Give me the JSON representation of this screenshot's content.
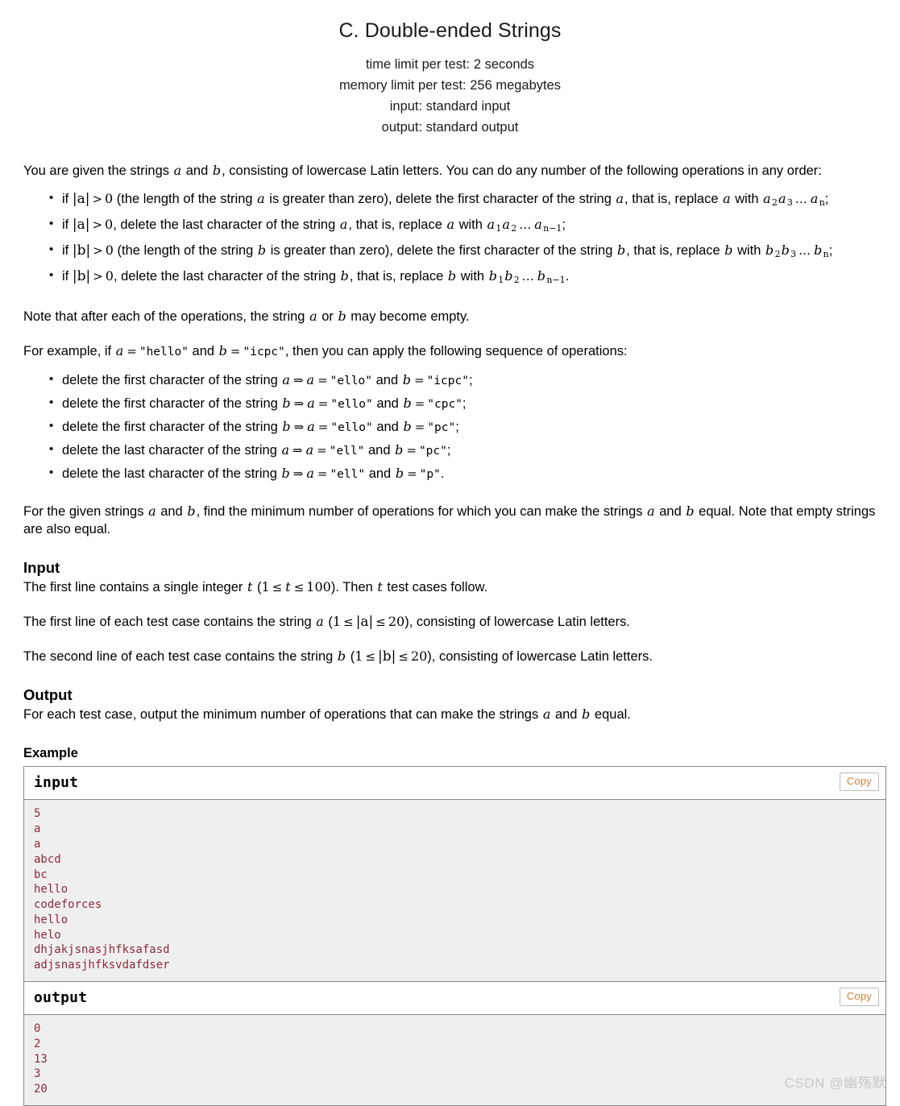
{
  "problem": {
    "title": "C. Double-ended Strings",
    "limits": [
      "time limit per test: 2 seconds",
      "memory limit per test: 256 megabytes",
      "input: standard input",
      "output: standard output"
    ],
    "intro": {
      "lead": "You are given the strings ",
      "var_a": "a",
      "mid": " and ",
      "var_b": "b",
      "tail": ", consisting of lowercase Latin letters. You can do any number of the following operations in any order:"
    },
    "operations": [
      {
        "p1": "if ",
        "abs": "|a|",
        "cmp": ">",
        "zero": "0",
        "p2": " (the length of the string ",
        "v1": "a",
        "p3": " is greater than zero), delete the first character of the string ",
        "v2": "a",
        "p4": ", that is, replace ",
        "v3": "a",
        "p5": " with ",
        "expr_base1": "a",
        "expr_sub1": "2",
        "expr_base2": "a",
        "expr_sub2": "3",
        "dots": "…",
        "expr_base3": "a",
        "expr_sub3": "n",
        "end": ";"
      },
      {
        "p1": "if ",
        "abs": "|a|",
        "cmp": ">",
        "zero": "0",
        "p2": ", delete the last character of the string ",
        "v1": "a",
        "p4": ", that is, replace ",
        "v3": "a",
        "p5": " with ",
        "expr_base1": "a",
        "expr_sub1": "1",
        "expr_base2": "a",
        "expr_sub2": "2",
        "dots": "…",
        "expr_base3": "a",
        "expr_sub3": "n−1",
        "end": ";"
      },
      {
        "p1": "if ",
        "abs": "|b|",
        "cmp": ">",
        "zero": "0",
        "p2": " (the length of the string ",
        "v1": "b",
        "p3": " is greater than zero), delete the first character of the string ",
        "v2": "b",
        "p4": ", that is, replace ",
        "v3": "b",
        "p5": " with ",
        "expr_base1": "b",
        "expr_sub1": "2",
        "expr_base2": "b",
        "expr_sub2": "3",
        "dots": "…",
        "expr_base3": "b",
        "expr_sub3": "n",
        "end": ";"
      },
      {
        "p1": "if ",
        "abs": "|b|",
        "cmp": ">",
        "zero": "0",
        "p2": ", delete the last character of the string ",
        "v1": "b",
        "p4": ", that is, replace ",
        "v3": "b",
        "p5": " with ",
        "expr_base1": "b",
        "expr_sub1": "1",
        "expr_base2": "b",
        "expr_sub2": "2",
        "dots": "…",
        "expr_base3": "b",
        "expr_sub3": "n−1",
        "end": "."
      }
    ],
    "note": {
      "p1": "Note that after each of the operations, the string ",
      "v1": "a",
      "p2": " or ",
      "v2": "b",
      "p3": " may become empty."
    },
    "example_intro": {
      "p1": "For example, if ",
      "v1": "a",
      "eq1": "=",
      "s1": "\"hello\"",
      "p2": " and ",
      "v2": "b",
      "eq2": "=",
      "s2": "\"icpc\"",
      "p3": ", then you can apply the following sequence of operations:"
    },
    "example_steps": [
      {
        "action": "delete the first character of the string ",
        "target": "a",
        "arrow": "⇒",
        "va": "a",
        "eqa": "=",
        "sa": "\"ello\"",
        "and": " and ",
        "vb": "b",
        "eqb": "=",
        "sb": "\"icpc\"",
        "end": ";"
      },
      {
        "action": "delete the first character of the string ",
        "target": "b",
        "arrow": "⇒",
        "va": "a",
        "eqa": "=",
        "sa": "\"ello\"",
        "and": " and ",
        "vb": "b",
        "eqb": "=",
        "sb": "\"cpc\"",
        "end": ";"
      },
      {
        "action": "delete the first character of the string ",
        "target": "b",
        "arrow": "⇒",
        "va": "a",
        "eqa": "=",
        "sa": "\"ello\"",
        "and": " and ",
        "vb": "b",
        "eqb": "=",
        "sb": "\"pc\"",
        "end": ";"
      },
      {
        "action": "delete the last character of the string ",
        "target": "a",
        "arrow": "⇒",
        "va": "a",
        "eqa": "=",
        "sa": "\"ell\"",
        "and": " and ",
        "vb": "b",
        "eqb": "=",
        "sb": "\"pc\"",
        "end": ";"
      },
      {
        "action": "delete the last character of the string ",
        "target": "b",
        "arrow": "⇒",
        "va": "a",
        "eqa": "=",
        "sa": "\"ell\"",
        "and": " and ",
        "vb": "b",
        "eqb": "=",
        "sb": "\"p\"",
        "end": "."
      }
    ],
    "closing": {
      "p1": "For the given strings ",
      "v1": "a",
      "p2": " and ",
      "v2": "b",
      "p3": ", find the minimum number of operations for which you can make the strings ",
      "v3": "a",
      "p4": " and ",
      "v4": "b",
      "p5": " equal. Note that empty strings are also equal."
    },
    "input_section": {
      "heading": "Input",
      "line1": {
        "p1": "The first line contains a single integer ",
        "v1": "t",
        "p2": " (",
        "lo": "1",
        "le1": "≤",
        "v2": "t",
        "le2": "≤",
        "hi": "100",
        "p3": "). Then ",
        "v3": "t",
        "p4": " test cases follow."
      },
      "line2": {
        "p1": "The first line of each test case contains the string ",
        "v1": "a",
        "p2": " (",
        "lo": "1",
        "le1": "≤",
        "abs": "|a|",
        "le2": "≤",
        "hi": "20",
        "p3": "), consisting of lowercase Latin letters."
      },
      "line3": {
        "p1": "The second line of each test case contains the string ",
        "v1": "b",
        "p2": " (",
        "lo": "1",
        "le1": "≤",
        "abs": "|b|",
        "le2": "≤",
        "hi": "20",
        "p3": "), consisting of lowercase Latin letters."
      }
    },
    "output_section": {
      "heading": "Output",
      "line1": {
        "p1": "For each test case, output the minimum number of operations that can make the strings ",
        "v1": "a",
        "p2": " and ",
        "v2": "b",
        "p3": " equal."
      }
    },
    "example_section": {
      "heading": "Example",
      "input_label": "input",
      "output_label": "output",
      "copy_label": "Copy",
      "input_data": "5\na\na\nabcd\nbc\nhello\ncodeforces\nhello\nhelo\ndhjakjsnasjhfksafasd\nadjsnasjhfksvdafdser",
      "output_data": "0\n2\n13\n3\n20"
    }
  },
  "watermark": {
    "text": "CSDN @幽殇默"
  },
  "colors": {
    "sample_text": "#8b2b3a",
    "sample_bg": "#efefef",
    "border": "#888888",
    "copy_text": "#c8833c",
    "watermark": "#c9c9c9"
  }
}
